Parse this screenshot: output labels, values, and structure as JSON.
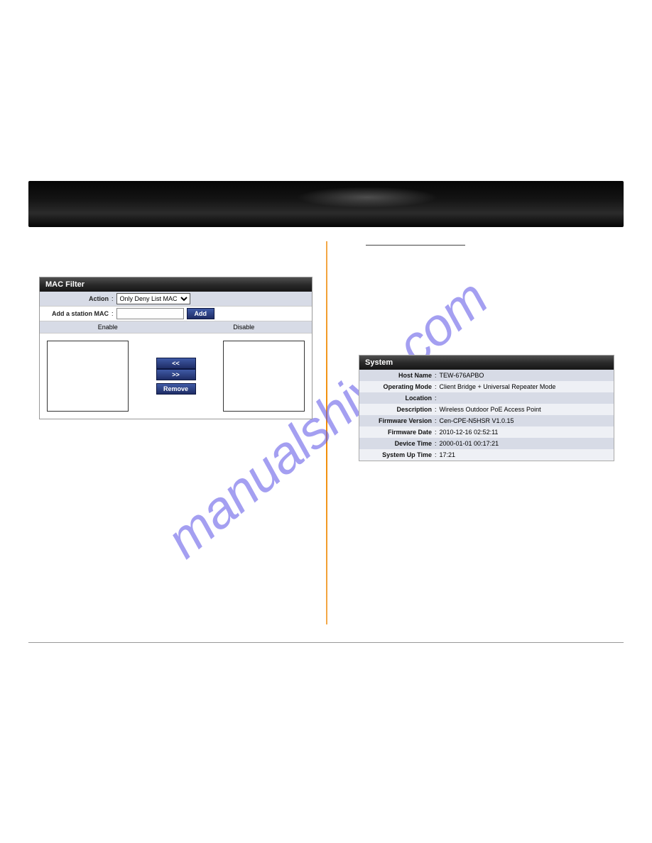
{
  "watermark": "manualshive.com",
  "mac_filter": {
    "title": "MAC Filter",
    "action_label": "Action",
    "action_value": "Only Deny List MAC",
    "add_label": "Add a station MAC",
    "add_button": "Add",
    "col_enable": "Enable",
    "col_disable": "Disable",
    "btn_left": "<<",
    "btn_right": ">>",
    "btn_remove": "Remove"
  },
  "system": {
    "title": "System",
    "rows": [
      {
        "label": "Host Name",
        "value": "TEW-676APBO"
      },
      {
        "label": "Operating Mode",
        "value": "Client Bridge + Universal Repeater Mode"
      },
      {
        "label": "Location",
        "value": ""
      },
      {
        "label": "Description",
        "value": "Wireless Outdoor PoE Access Point"
      },
      {
        "label": "Firmware Version",
        "value": "Cen-CPE-N5HSR V1.0.15"
      },
      {
        "label": "Firmware Date",
        "value": "2010-12-16 02:52:11"
      },
      {
        "label": "Device Time",
        "value": "2000-01-01 00:17:21"
      },
      {
        "label": "System Up Time",
        "value": "17:21"
      }
    ]
  }
}
